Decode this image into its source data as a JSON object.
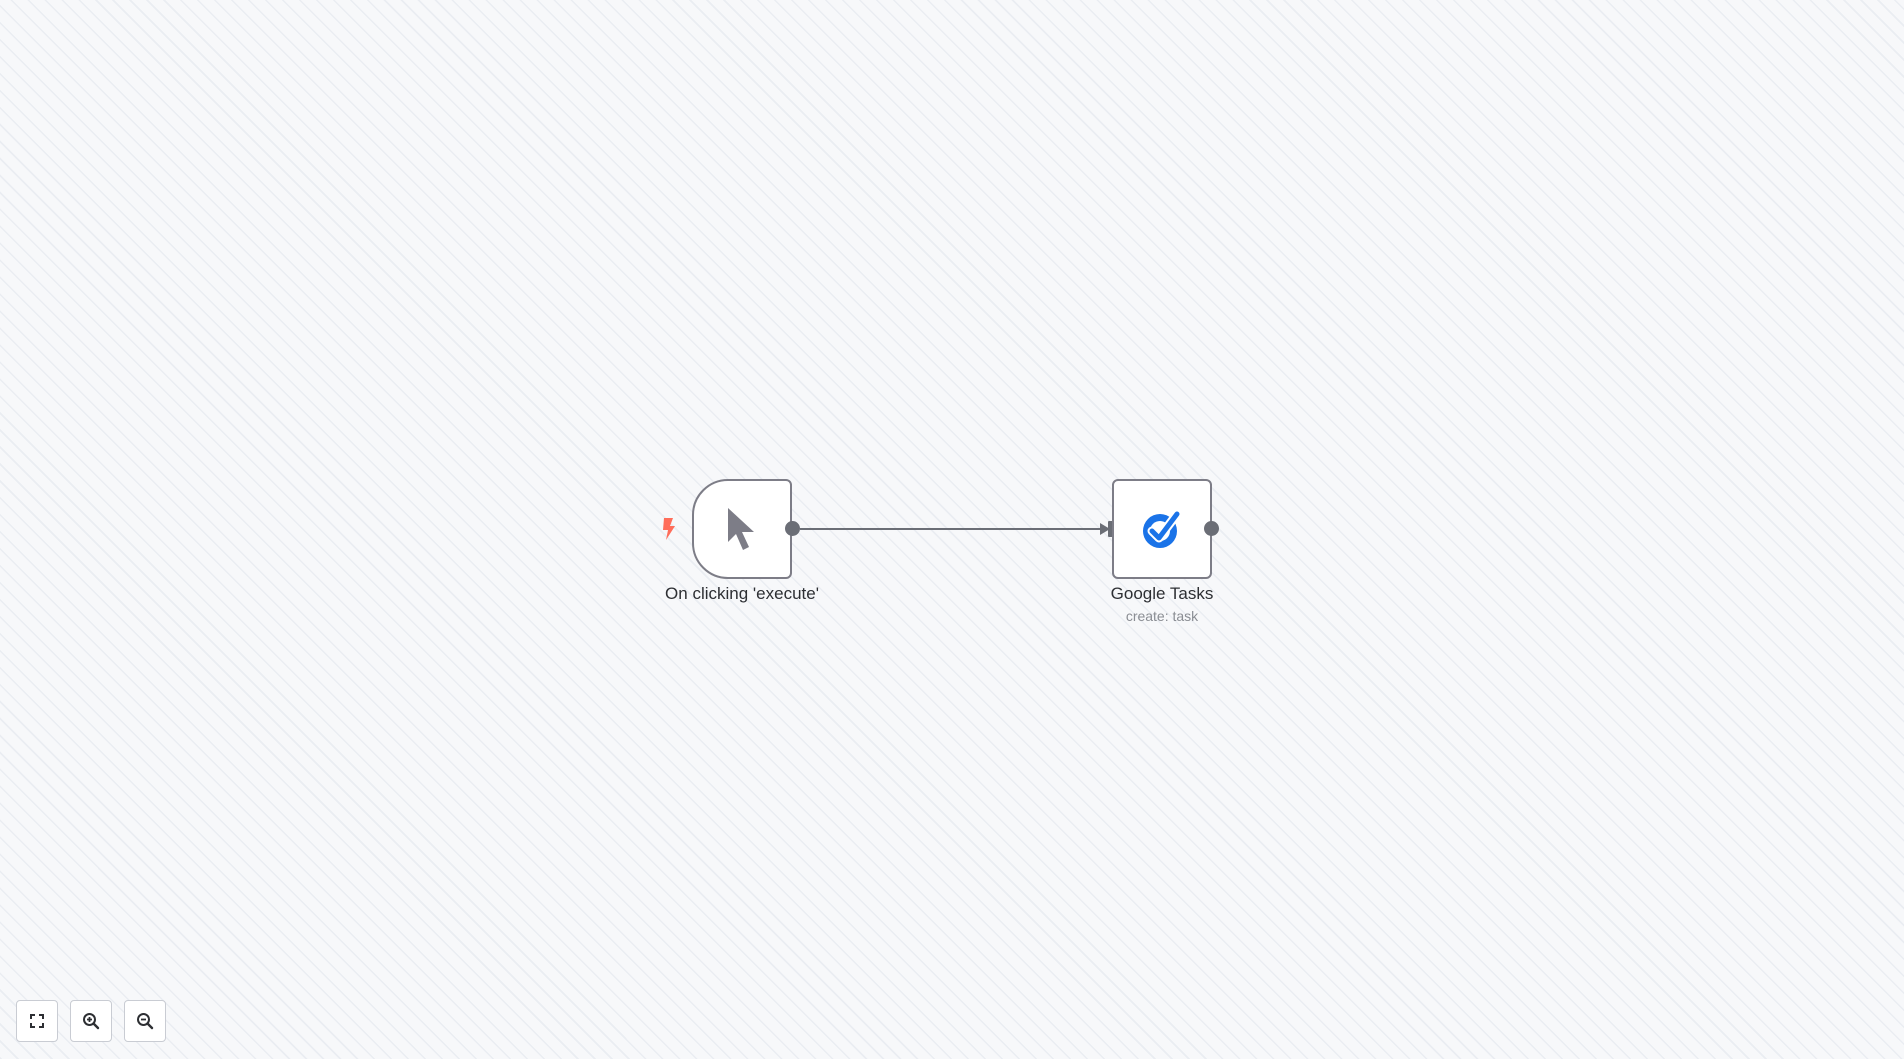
{
  "workflow": {
    "nodes": [
      {
        "id": "trigger",
        "label": "On clicking 'execute'",
        "subtitle": "",
        "icon": "mouse-pointer-icon",
        "kind": "trigger"
      },
      {
        "id": "google-tasks",
        "label": "Google Tasks",
        "subtitle": "create: task",
        "icon": "google-tasks-icon",
        "kind": "action"
      }
    ],
    "connections": [
      {
        "from": "trigger",
        "to": "google-tasks"
      }
    ]
  },
  "colors": {
    "canvas_background": "#f7f8fa",
    "node_border": "#7d7d87",
    "handle": "#6b6e76",
    "trigger_bolt": "#ff6d5a",
    "google_tasks_blue": "#1a73e8",
    "label_text": "#2d2f33",
    "sublabel_text": "#8a8d93"
  },
  "controls": [
    {
      "name": "zoom-to-fit",
      "icon": "fit-screen-icon"
    },
    {
      "name": "zoom-in",
      "icon": "zoom-in-icon"
    },
    {
      "name": "zoom-out",
      "icon": "zoom-out-icon"
    }
  ]
}
